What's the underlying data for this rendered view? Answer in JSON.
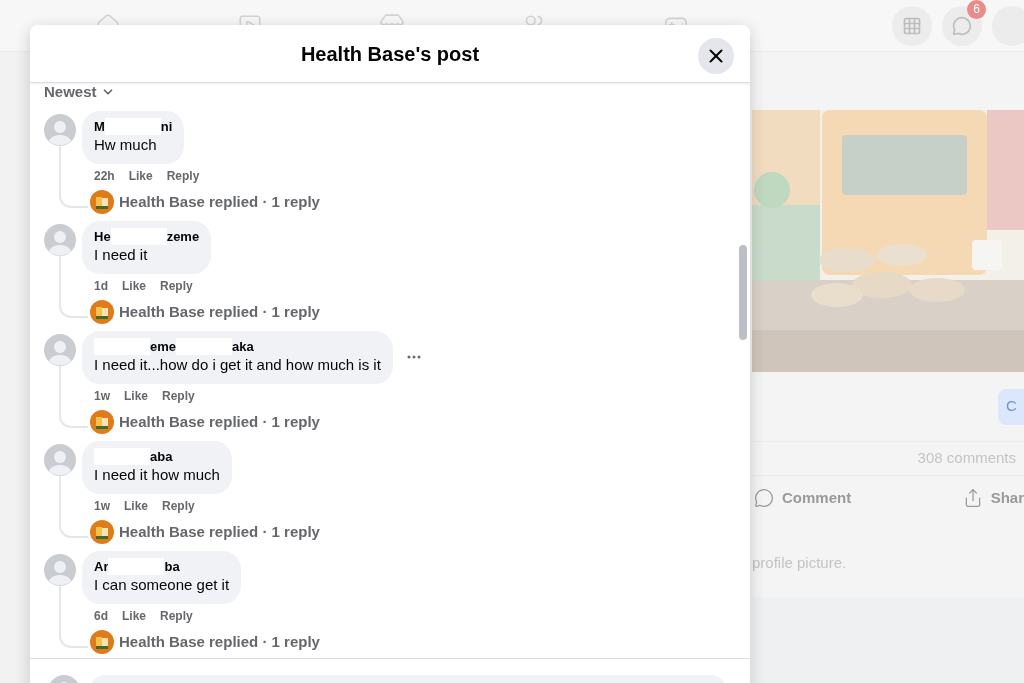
{
  "background": {
    "notification_badge": "6",
    "button": "C",
    "comment_count": "308 comments",
    "actions": [
      {
        "kind": "comment",
        "label": "Comment"
      },
      {
        "kind": "share",
        "label": "Shar"
      }
    ],
    "caption": "profile picture."
  },
  "dialog": {
    "title": "Health Base's post",
    "sort": "Newest",
    "comments": [
      {
        "name_parts": [
          "M",
          "ni"
        ],
        "text": "Hw much",
        "time": "22h",
        "like": "Like",
        "reply": "Reply",
        "replies_summary": "Health Base replied · 1 reply",
        "more": false
      },
      {
        "name_parts": [
          "He",
          "zeme"
        ],
        "text": "I need it",
        "time": "1d",
        "like": "Like",
        "reply": "Reply",
        "replies_summary": "Health Base replied · 1 reply",
        "more": false
      },
      {
        "leading_redaction": true,
        "name_parts": [
          "eme",
          "aka"
        ],
        "text": "I need it...how do i get it and how much is it",
        "time": "1w",
        "like": "Like",
        "reply": "Reply",
        "replies_summary": "Health Base replied · 1 reply",
        "more": true
      },
      {
        "leading_redaction": true,
        "name_parts": [
          "aba"
        ],
        "text": "I need it how much",
        "time": "1w",
        "like": "Like",
        "reply": "Reply",
        "replies_summary": "Health Base replied · 1 reply",
        "more": false
      },
      {
        "name_parts": [
          "Ar",
          "ba"
        ],
        "text": "I can someone get it",
        "time": "6d",
        "like": "Like",
        "reply": "Reply",
        "replies_summary": "Health Base replied · 1 reply",
        "more": false
      }
    ]
  }
}
